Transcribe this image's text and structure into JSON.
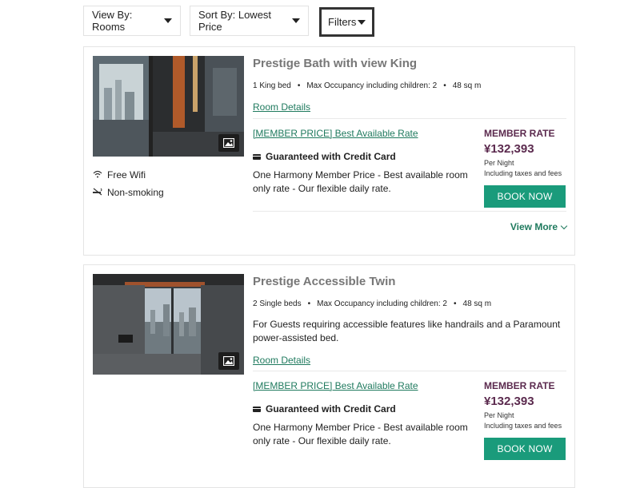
{
  "toolbar": {
    "view_label": "View By: Rooms",
    "sort_label": "Sort By: Lowest Price",
    "filters_label": "Filters"
  },
  "rooms": [
    {
      "title": "Prestige Bath with view King",
      "beds": "1 King bed",
      "occupancy": "Max Occupancy including children: 2",
      "size": "48 sq m",
      "room_details": "Room Details",
      "amenities": [
        "Free Wifi",
        "Non-smoking"
      ],
      "rate": {
        "name": "[MEMBER PRICE] Best Available Rate",
        "guarantee": "Guaranteed with Credit Card",
        "description": "One Harmony Member Price - Best available room only rate - Our flexible daily rate.",
        "member_label": "MEMBER RATE",
        "price": "¥132,393",
        "per": "Per Night",
        "tax": "Including taxes and fees",
        "book": "BOOK NOW"
      },
      "view_more": "View More"
    },
    {
      "title": "Prestige Accessible Twin",
      "beds": "2 Single beds",
      "occupancy": "Max Occupancy including children: 2",
      "size": "48 sq m",
      "description": "For Guests requiring accessible features like handrails and a Paramount power-assisted bed.",
      "room_details": "Room Details",
      "rate": {
        "name": "[MEMBER PRICE] Best Available Rate",
        "guarantee": "Guaranteed with Credit Card",
        "description": "One Harmony Member Price - Best available room only rate - Our flexible daily rate.",
        "member_label": "MEMBER RATE",
        "price": "¥132,393",
        "per": "Per Night",
        "tax": "Including taxes and fees",
        "book": "BOOK NOW"
      }
    }
  ],
  "colors": {
    "accent": "#1a9b7b",
    "link": "#1f7a5e",
    "member": "#5b2a4e"
  }
}
